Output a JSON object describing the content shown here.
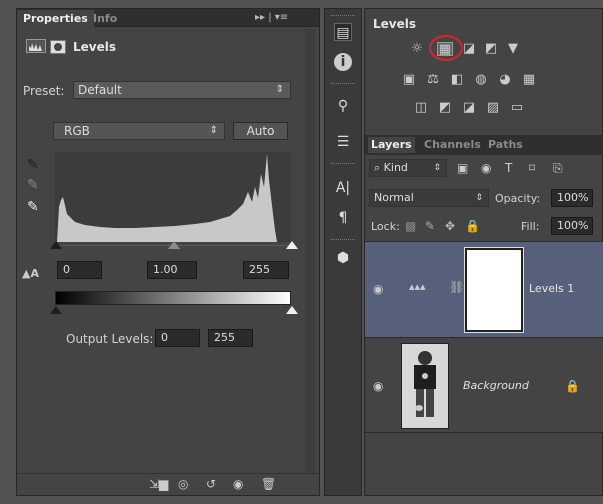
{
  "properties": {
    "tab_active": "Properties",
    "tab_inactive": "Info",
    "menu_glyph": "▸▸ | ▾≡",
    "adjustment_title": "Levels",
    "preset_label": "Preset:",
    "preset_value": "Default",
    "channel_value": "RGB",
    "auto_label": "Auto",
    "input_black": "0",
    "input_gamma": "1.00",
    "input_white": "255",
    "output_label": "Output Levels:",
    "output_black": "0",
    "output_white": "255",
    "icons": [
      "levels-icon",
      "mask-icon",
      "eyedropper-black-icon",
      "eyedropper-gray-icon",
      "eyedropper-white-icon",
      "auto-levels-icon",
      "clip-to-layer-icon",
      "view-previous-icon",
      "reset-icon",
      "visibility-icon",
      "trash-icon"
    ]
  },
  "adjustments": {
    "title": "Levels",
    "highlighted": "levels",
    "row1": [
      "☼",
      "▦",
      "◪",
      "◩",
      "▼"
    ],
    "row2": [
      "▣",
      "⚖",
      "◧",
      "◍",
      "◕",
      "▦"
    ],
    "row3": [
      "◫",
      "◩",
      "◪",
      "▨",
      "▭"
    ]
  },
  "layers": {
    "tabs": [
      "Layers",
      "Channels",
      "Paths"
    ],
    "filter_label": "Kind",
    "filter_glyphs": [
      "▣",
      "◉",
      "T",
      "⌑",
      "⎘"
    ],
    "blend_mode": "Normal",
    "opacity_label": "Opacity:",
    "opacity_value": "100%",
    "lock_label": "Lock:",
    "fill_label": "Fill:",
    "fill_value": "100%",
    "items": [
      {
        "name": "Levels 1",
        "selected": true
      },
      {
        "name": "Background",
        "selected": false
      }
    ]
  },
  "histogram": {
    "channel": "RGB",
    "level_black": 0,
    "level_gamma": 1.0,
    "level_white": 255
  },
  "colors": {
    "panel_bg": "#444444",
    "tab_bar": "#2f2f2f",
    "selected_layer": "#56607a",
    "highlight_ring": "#d8262a",
    "histogram_fill": "#c8c8c8"
  }
}
